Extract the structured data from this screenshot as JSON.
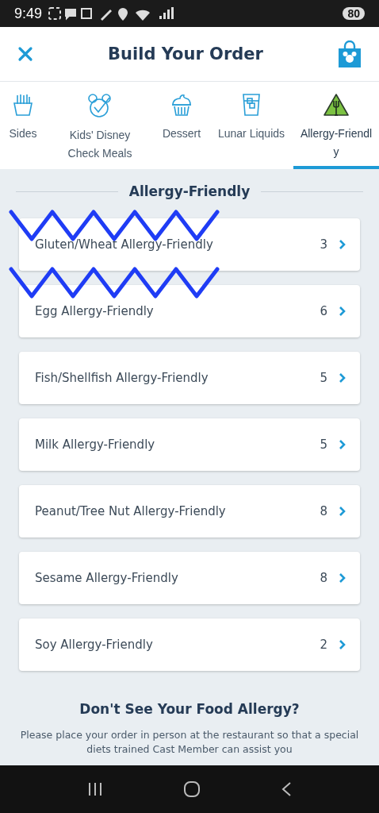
{
  "status_bar": {
    "time": "9:49",
    "battery": "80"
  },
  "header": {
    "title": "Build Your Order"
  },
  "tabs": [
    {
      "label": "Sides",
      "kind": "fries",
      "selected": false
    },
    {
      "label": "Kids' Disney Check Meals",
      "kind": "check",
      "selected": false
    },
    {
      "label": "Dessert",
      "kind": "cupcake",
      "selected": false
    },
    {
      "label": "Lunar Liquids",
      "kind": "drink",
      "selected": false
    },
    {
      "label": "Allergy-Friendly",
      "kind": "allergy",
      "selected": true
    }
  ],
  "section": {
    "title": "Allergy-Friendly"
  },
  "categories": [
    {
      "name": "Gluten/Wheat Allergy-Friendly",
      "count": "3"
    },
    {
      "name": "Egg Allergy-Friendly",
      "count": "6"
    },
    {
      "name": "Fish/Shellfish Allergy-Friendly",
      "count": "5"
    },
    {
      "name": "Milk Allergy-Friendly",
      "count": "5"
    },
    {
      "name": "Peanut/Tree Nut Allergy-Friendly",
      "count": "8"
    },
    {
      "name": "Sesame Allergy-Friendly",
      "count": "8"
    },
    {
      "name": "Soy Allergy-Friendly",
      "count": "2"
    }
  ],
  "footer": {
    "title": "Don't See Your Food Allergy?",
    "text": "Please place your order in person at the restaurant so that a special diets trained Cast Member can assist you"
  }
}
